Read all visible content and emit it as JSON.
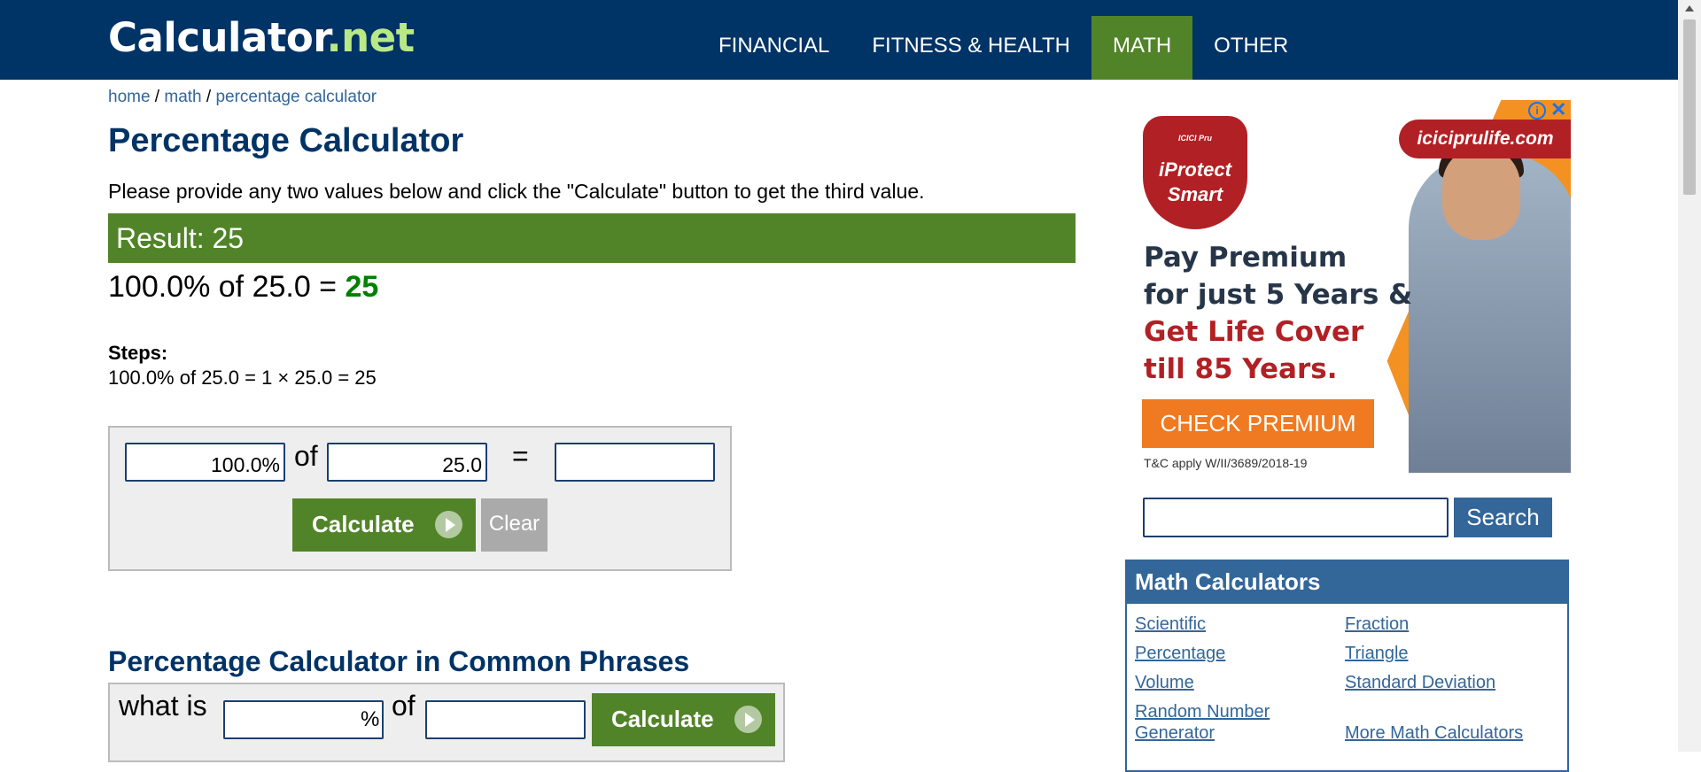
{
  "header": {
    "logo_main": "Calculator",
    "logo_tld": ".net",
    "nav": [
      "FINANCIAL",
      "FITNESS & HEALTH",
      "MATH",
      "OTHER"
    ],
    "active_nav": "MATH",
    "colors": {
      "bar": "#003366",
      "active": "#518428",
      "logo_tld": "#b8e986"
    }
  },
  "breadcrumb": {
    "home": "home",
    "sep1": " / ",
    "math": "math",
    "sep2": " / ",
    "current": "percentage calculator"
  },
  "main": {
    "title": "Percentage Calculator",
    "intro": "Please provide any two values below and click the \"Calculate\" button to get the third value.",
    "result_label": "Result: 25",
    "equation": "100.0% of 25.0 = ",
    "equation_answer": "25",
    "steps_title": "Steps:",
    "steps_line": "100.0% of 25.0 = 1 × 25.0 = 25",
    "calc": {
      "percent_value": "100.0%",
      "of_label": "of",
      "base_value": "25.0",
      "equals_label": "=",
      "result_value": "",
      "calculate_label": "Calculate",
      "clear_label": "Clear"
    },
    "phrases_title": "Percentage Calculator in Common Phrases",
    "phrase1": {
      "what_is": "what is",
      "percent_value": "",
      "percent_sign": "%",
      "of_label": "of",
      "base_value": "",
      "calculate_label": "Calculate"
    }
  },
  "ad": {
    "badge_small": "ICICI Pru",
    "badge_top": "iProtect",
    "badge_bottom": "Smart",
    "site": "iciciprulife.com",
    "line1": "Pay Premium",
    "line2": "for just 5 Years &",
    "line3": "Get Life Cover",
    "line4": "till 85 Years.",
    "cta": "CHECK PREMIUM",
    "fine_print": "T&C apply W/II/3689/2018-19",
    "info": "i",
    "close": "✕"
  },
  "sidebar": {
    "search_value": "",
    "search_label": "Search",
    "math_title": "Math Calculators",
    "links_col1": [
      "Scientific",
      "Percentage",
      "Volume",
      "Random Number",
      "Generator"
    ],
    "links_col2": [
      "Fraction",
      "Triangle",
      "Standard Deviation",
      "More Math Calculators"
    ]
  }
}
